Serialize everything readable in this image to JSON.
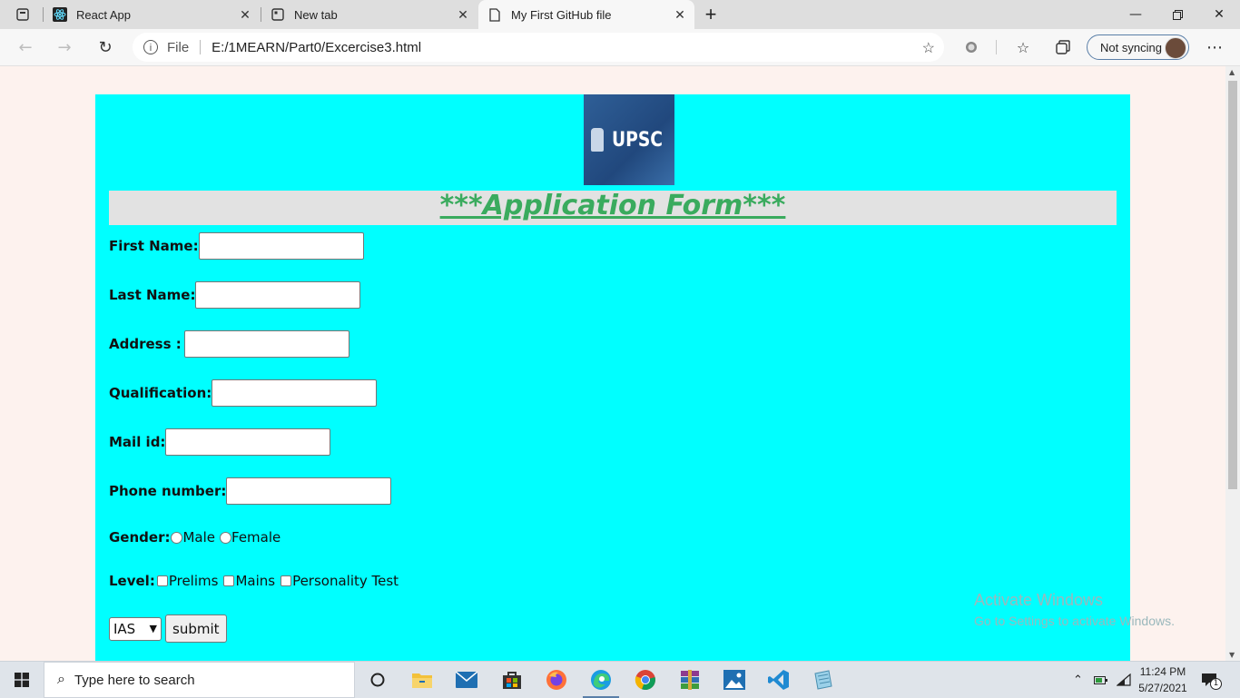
{
  "browser": {
    "tabs": [
      {
        "title": "React App"
      },
      {
        "title": "New tab"
      },
      {
        "title": "My First GitHub file"
      }
    ],
    "url_protocol": "File",
    "url": "E:/1MEARN/Part0/Excercise3.html",
    "sync_label": "Not syncing"
  },
  "page": {
    "logo_text": "UPSC",
    "heading": "***Application Form***",
    "fields": [
      {
        "label": "First Name:",
        "value": ""
      },
      {
        "label": "Last Name:",
        "value": ""
      },
      {
        "label": "Address :",
        "value": ""
      },
      {
        "label": "Qualification:",
        "value": ""
      },
      {
        "label": "Mail id:",
        "value": ""
      },
      {
        "label": "Phone number:",
        "value": ""
      }
    ],
    "gender": {
      "label": "Gender:",
      "options": [
        "Male",
        "Female"
      ]
    },
    "level": {
      "label": "Level:",
      "options": [
        "Prelims",
        "Mains",
        "Personality Test"
      ]
    },
    "exam_select": {
      "selected": "IAS"
    },
    "submit_label": "submit"
  },
  "watermark": {
    "line1": "Activate Windows",
    "line2": "Go to Settings to activate Windows."
  },
  "taskbar": {
    "search_placeholder": "Type here to search",
    "time": "11:24 PM",
    "date": "5/27/2021",
    "notification_count": "1"
  },
  "colors": {
    "card_bg": "#00ffff",
    "heading_bg": "#e2e2e2",
    "heading_text": "#3aab5e",
    "page_bg": "#fdf2ee"
  }
}
